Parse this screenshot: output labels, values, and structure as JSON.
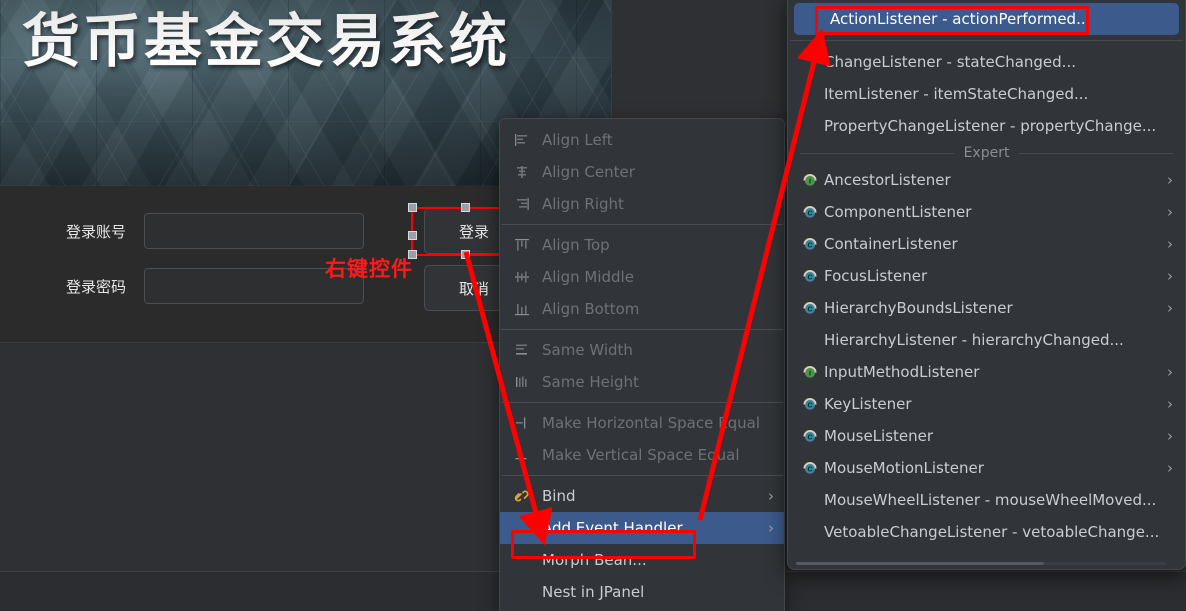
{
  "app_form": {
    "banner_title": "货币基金交易系统",
    "fields": [
      {
        "label": "登录账号",
        "value": "",
        "placeholder": ""
      },
      {
        "label": "登录密码",
        "value": "",
        "placeholder": ""
      }
    ],
    "buttons": [
      {
        "label": "登录"
      },
      {
        "label": "取消"
      }
    ],
    "annotation": "右键控件"
  },
  "context_menu": {
    "items": [
      {
        "label": "Align Left",
        "icon": "align-left-icon",
        "enabled": false,
        "submenu": false,
        "selected": false
      },
      {
        "label": "Align Center",
        "icon": "align-center-icon",
        "enabled": false,
        "submenu": false,
        "selected": false
      },
      {
        "label": "Align Right",
        "icon": "align-right-icon",
        "enabled": false,
        "submenu": false,
        "selected": false
      },
      {
        "label": "Align Top",
        "icon": "align-top-icon",
        "enabled": false,
        "submenu": false,
        "selected": false
      },
      {
        "label": "Align Middle",
        "icon": "align-middle-icon",
        "enabled": false,
        "submenu": false,
        "selected": false
      },
      {
        "label": "Align Bottom",
        "icon": "align-bottom-icon",
        "enabled": false,
        "submenu": false,
        "selected": false
      },
      {
        "label": "Same Width",
        "icon": "same-width-icon",
        "enabled": false,
        "submenu": false,
        "selected": false
      },
      {
        "label": "Same Height",
        "icon": "same-height-icon",
        "enabled": false,
        "submenu": false,
        "selected": false
      },
      {
        "label": "Make Horizontal Space Equal",
        "icon": "h-space-equal-icon",
        "enabled": false,
        "submenu": false,
        "selected": false
      },
      {
        "label": "Make Vertical Space Equal",
        "icon": "v-space-equal-icon",
        "enabled": false,
        "submenu": false,
        "selected": false
      },
      {
        "label": "Bind",
        "icon": "bind-link-icon",
        "enabled": true,
        "submenu": true,
        "selected": false
      },
      {
        "label": "Add Event Handler",
        "icon": "none",
        "enabled": true,
        "submenu": true,
        "selected": true
      },
      {
        "label": "Morph Bean...",
        "icon": "none",
        "enabled": true,
        "submenu": false,
        "selected": false
      },
      {
        "label": "Nest in JPanel",
        "icon": "none",
        "enabled": true,
        "submenu": false,
        "selected": false
      }
    ],
    "separator_after": [
      2,
      5,
      7,
      9
    ]
  },
  "listener_menu": {
    "group_header": "Expert",
    "items": [
      {
        "label": "ActionListener - actionPerformed...",
        "icon": "none",
        "submenu": false,
        "selected": true
      },
      {
        "label": "ChangeListener - stateChanged...",
        "icon": "none",
        "submenu": false,
        "selected": false
      },
      {
        "label": "ItemListener - itemStateChanged...",
        "icon": "none",
        "submenu": false,
        "selected": false
      },
      {
        "label": "PropertyChangeListener - propertyChange...",
        "icon": "none",
        "submenu": false,
        "selected": false
      },
      {
        "label": "AncestorListener",
        "icon": "interface-icon",
        "submenu": true,
        "selected": false
      },
      {
        "label": "ComponentListener",
        "icon": "class-icon",
        "submenu": true,
        "selected": false
      },
      {
        "label": "ContainerListener",
        "icon": "class-icon",
        "submenu": true,
        "selected": false
      },
      {
        "label": "FocusListener",
        "icon": "class-icon",
        "submenu": true,
        "selected": false
      },
      {
        "label": "HierarchyBoundsListener",
        "icon": "class-icon",
        "submenu": true,
        "selected": false
      },
      {
        "label": "HierarchyListener - hierarchyChanged...",
        "icon": "none",
        "submenu": false,
        "selected": false
      },
      {
        "label": "InputMethodListener",
        "icon": "interface-icon",
        "submenu": true,
        "selected": false
      },
      {
        "label": "KeyListener",
        "icon": "class-icon",
        "submenu": true,
        "selected": false
      },
      {
        "label": "MouseListener",
        "icon": "class-icon",
        "submenu": true,
        "selected": false
      },
      {
        "label": "MouseMotionListener",
        "icon": "class-icon",
        "submenu": true,
        "selected": false
      },
      {
        "label": "MouseWheelListener - mouseWheelMoved...",
        "icon": "none",
        "submenu": false,
        "selected": false
      },
      {
        "label": "VetoableChangeListener - vetoableChange...",
        "icon": "none",
        "submenu": false,
        "selected": false
      }
    ],
    "group_before_index": 4
  },
  "colors": {
    "selection_blue": "#3c5a8c",
    "annotation_red": "#ff0000",
    "menu_background": "#313438",
    "canvas_background": "#2f3033",
    "interface_icon_green": "#4e9a4e",
    "class_icon_blue": "#3d8ab0"
  }
}
